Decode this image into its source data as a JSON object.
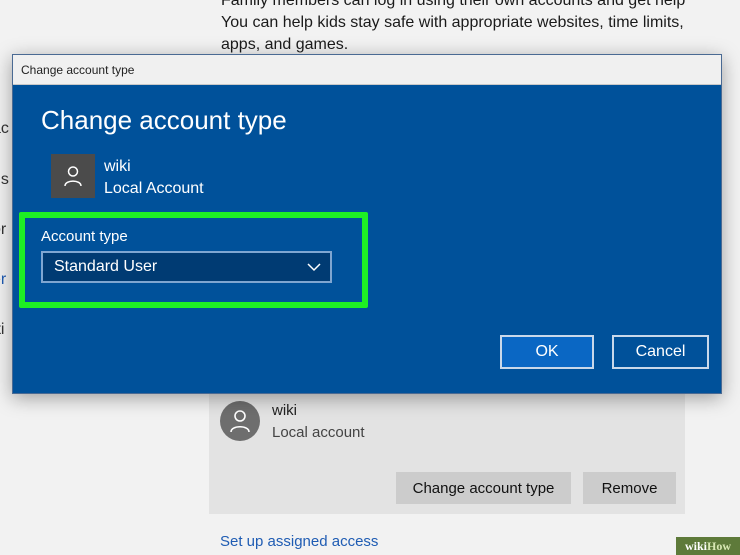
{
  "background": {
    "top_text_lines": [
      "Family members can log in using their own accounts and get help",
      "You can help kids stay safe with appropriate websites, time limits,",
      "apps, and games."
    ],
    "left_fragments": [
      "ac",
      "ns",
      "or",
      "er",
      "tti"
    ],
    "account_card": {
      "name": "wiki",
      "type": "Local account",
      "change_button": "Change account type",
      "remove_button": "Remove"
    },
    "assigned_access_link": "Set up assigned access"
  },
  "dialog": {
    "window_title": "Change account type",
    "heading": "Change account type",
    "user": {
      "name": "wiki",
      "kind": "Local Account"
    },
    "account_type_label": "Account type",
    "account_type_value": "Standard User",
    "ok_label": "OK",
    "cancel_label": "Cancel",
    "highlight_color": "#1eef24",
    "accent_color": "#00519a"
  },
  "watermark": {
    "brand_wiki": "wiki",
    "brand_how": "How"
  }
}
